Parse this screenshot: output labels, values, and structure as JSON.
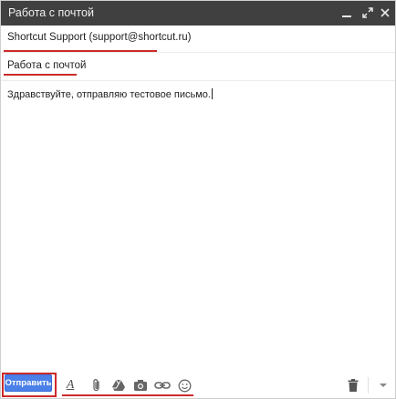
{
  "window": {
    "title": "Работа с почтой",
    "controls": [
      "minimize-icon",
      "expand-icon",
      "close-icon"
    ]
  },
  "compose": {
    "recipient": "Shortcut Support (support@shortcut.ru)",
    "subject": "Работа с почтой",
    "body": "Здравствуйте, отправляю тестовое письмо."
  },
  "toolbar": {
    "send_label": "Отправить",
    "format_icon_glyph": "A",
    "tools": [
      "formatting-icon",
      "attach-icon",
      "drive-icon",
      "photo-icon",
      "link-icon",
      "emoji-icon"
    ],
    "right_tools": [
      "trash-icon",
      "more-options-icon"
    ]
  },
  "colors": {
    "titlebar": "#404040",
    "send_button": "#4a80e8",
    "highlight": "#cc2a2a"
  }
}
